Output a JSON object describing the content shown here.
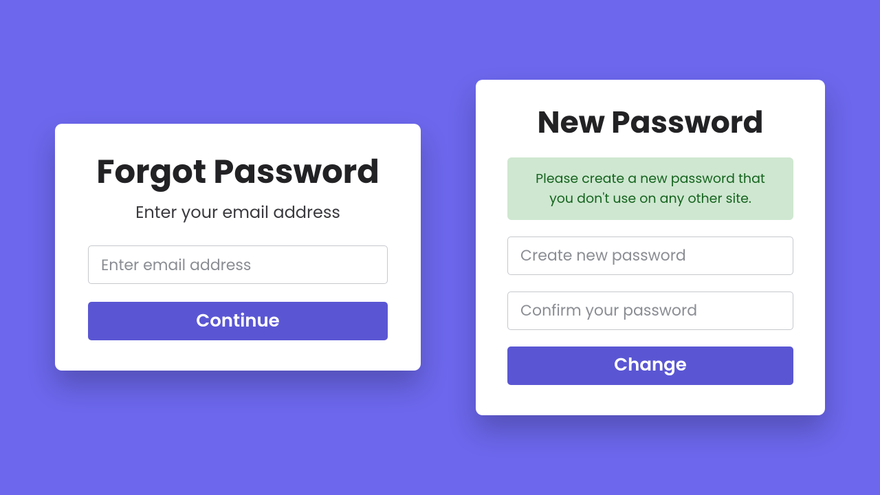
{
  "colors": {
    "background": "#6c67ec",
    "accent": "#5a56d3",
    "banner_bg": "#cfe7d1",
    "banner_text": "#16641f"
  },
  "forgot": {
    "title": "Forgot Password",
    "subtitle": "Enter your email address",
    "email_placeholder": "Enter email address",
    "submit_label": "Continue"
  },
  "newpwd": {
    "title": "New Password",
    "banner_text": "Please create a new password that you don't use on any other site.",
    "password_placeholder": "Create new password",
    "confirm_placeholder": "Confirm your password",
    "submit_label": "Change"
  }
}
